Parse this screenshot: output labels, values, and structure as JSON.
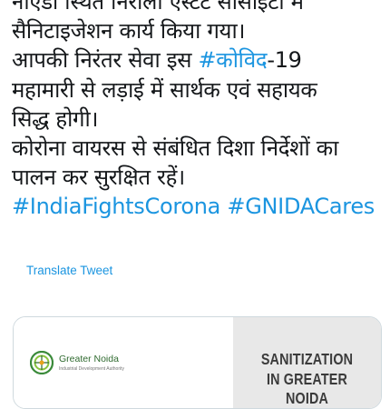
{
  "tweet": {
    "lines": [
      [
        {
          "text": "नोएडा स्थित निराला एस्टेट सोसाइटी में"
        }
      ],
      [
        {
          "text": "सैनिटाइजेशन कार्य किया गया।"
        }
      ],
      [
        {
          "text": "आपकी निरंतर सेवा इस "
        },
        {
          "text": "#कोविद",
          "tag": true
        },
        {
          "text": "-19"
        }
      ],
      [
        {
          "text": "महामारी से लड़ाई में सार्थक एवं सहायक"
        }
      ],
      [
        {
          "text": "सिद्ध होगी।"
        }
      ],
      [
        {
          "text": "कोरोना वायरस से संबंधित दिशा निर्देशों का"
        }
      ],
      [
        {
          "text": "पालन कर सुरक्षित रहें।"
        }
      ],
      [
        {
          "text": "#IndiaFightsCorona",
          "tag": true
        },
        {
          "text": " "
        },
        {
          "text": "#GNIDACares",
          "tag": true
        }
      ]
    ],
    "translate_label": "Translate Tweet"
  },
  "card": {
    "logo_text": "Greater Noida",
    "logo_subtext": "Industrial Development Authority",
    "headline_line1": "SANITIZATION",
    "headline_line2": "IN GREATER NOIDA"
  },
  "colors": {
    "hashtag": "#1b95e0",
    "text": "#14171a",
    "card_panel": "#e8e8e8",
    "logo_green": "#3a8a3a"
  },
  "icons": [
    "greater-noida-logo-icon"
  ]
}
